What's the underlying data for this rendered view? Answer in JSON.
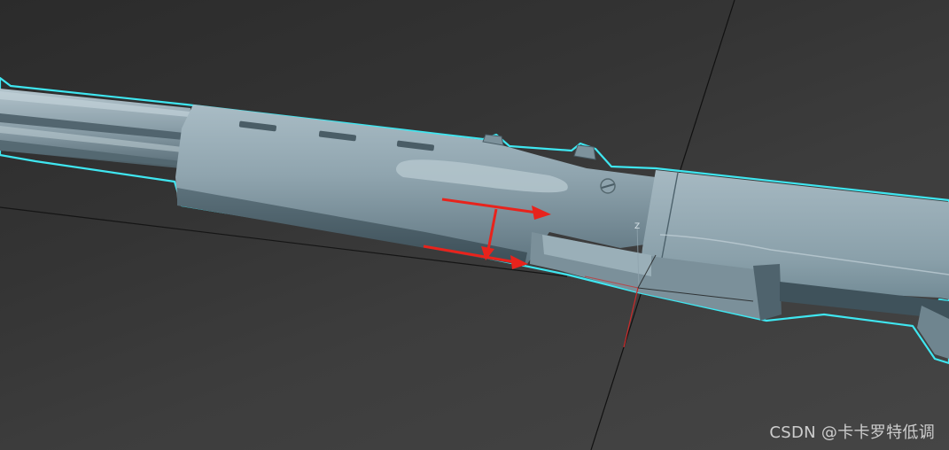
{
  "viewport": {
    "background_color": "#3a3a3a",
    "model": {
      "name": "rifle-model",
      "surface_color": "#8ea3ad",
      "selection_outline_color": "#3fe6f0"
    },
    "gizmo": {
      "axis_label": "Z",
      "axis_color": "#cc2a2a"
    },
    "annotation_arrows": {
      "color": "#e8231c",
      "count": 3
    }
  },
  "watermark": {
    "text": "CSDN @卡卡罗特低调"
  }
}
